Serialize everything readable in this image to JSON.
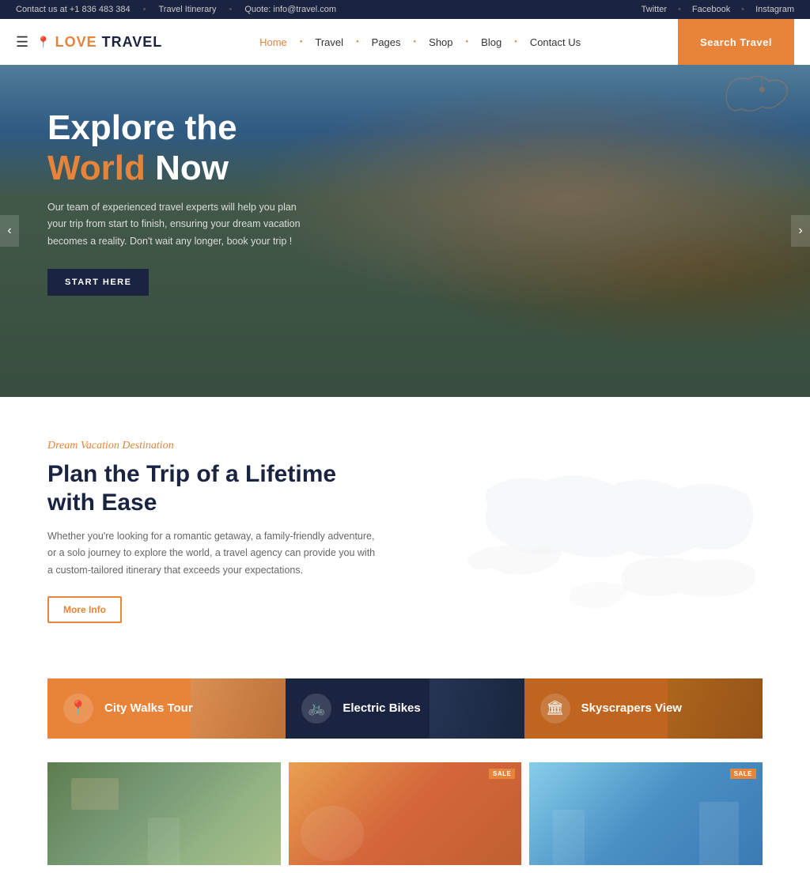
{
  "topbar": {
    "contact": "Contact us at +1 836 483 384",
    "itinerary": "Travel Itinerary",
    "quote": "Quote: info@travel.com",
    "social": [
      "Twitter",
      "Facebook",
      "Instagram"
    ]
  },
  "header": {
    "logo": "LOVE TRAVEL",
    "logo_accent": "LOVE",
    "search_btn": "Search Travel",
    "nav": [
      {
        "label": "Home",
        "active": true
      },
      {
        "label": "Travel",
        "active": false
      },
      {
        "label": "Pages",
        "active": false
      },
      {
        "label": "Shop",
        "active": false
      },
      {
        "label": "Blog",
        "active": false
      },
      {
        "label": "Contact Us",
        "active": false
      }
    ]
  },
  "hero": {
    "title_line1": "Explore the",
    "title_line2_orange": "World",
    "title_line2_white": " Now",
    "subtitle": "Our team of experienced travel experts will help you plan your trip from start to finish, ensuring your dream vacation becomes a reality. Don't wait any longer, book your trip !",
    "cta": "START HERE"
  },
  "dream_section": {
    "tag": "Dream Vacation Destination",
    "title": "Plan the Trip of a Lifetime with Ease",
    "desc": "Whether you're looking for a romantic getaway, a family-friendly adventure, or a solo journey to explore the world, a travel agency can provide you with a custom-tailored itinerary that exceeds your expectations.",
    "more_info": "More Info"
  },
  "tour_cards": [
    {
      "label": "City Walks Tour",
      "icon": "📍"
    },
    {
      "label": "Electric Bikes",
      "icon": "🚲"
    },
    {
      "label": "Skyscrapers View",
      "icon": "🏛"
    }
  ],
  "gallery": [
    {
      "has_sale": false
    },
    {
      "has_sale": true
    },
    {
      "has_sale": true
    }
  ],
  "sale_badge": "SALE"
}
